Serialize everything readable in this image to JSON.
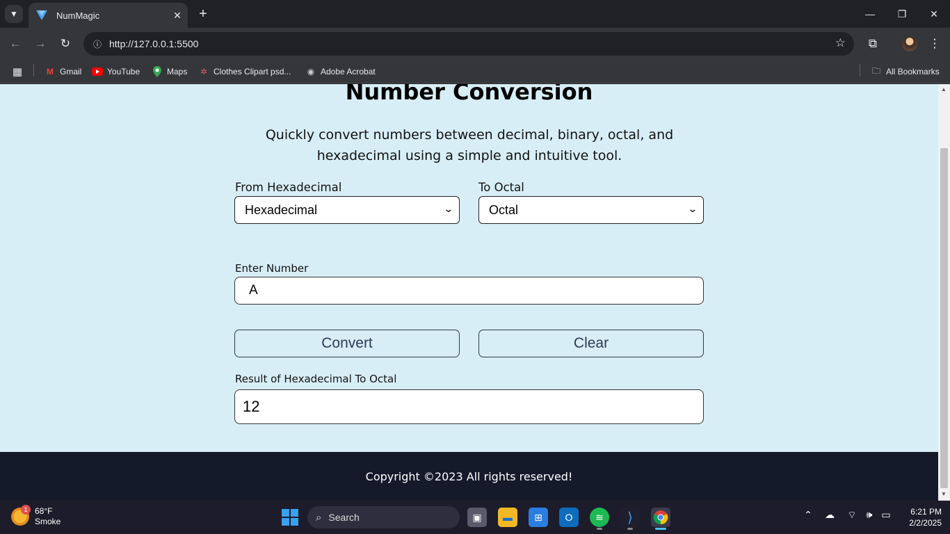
{
  "browser": {
    "tab_title": "NumMagic",
    "url": "http://127.0.0.1:5500",
    "bookmarks": [
      {
        "label": "Gmail",
        "icon": "gmail-icon"
      },
      {
        "label": "YouTube",
        "icon": "youtube-icon"
      },
      {
        "label": "Maps",
        "icon": "maps-icon"
      },
      {
        "label": "Clothes Clipart psd...",
        "icon": "clothes-clipart-icon"
      },
      {
        "label": "Adobe Acrobat",
        "icon": "adobe-acrobat-icon"
      }
    ],
    "all_bookmarks": "All Bookmarks"
  },
  "page": {
    "heading": "Number Conversion",
    "description": "Quickly convert numbers between decimal, binary, octal, and hexadecimal using a simple and intuitive tool.",
    "from_label": "From Hexadecimal",
    "from_value": "Hexadecimal",
    "to_label": "To Octal",
    "to_value": "Octal",
    "input_label": "Enter Number",
    "input_value": "A",
    "convert_label": "Convert",
    "clear_label": "Clear",
    "result_label": "Result of Hexadecimal To Octal",
    "result_value": "12",
    "footer": "Copyright ©2023 All rights reserved!"
  },
  "taskbar": {
    "weather_temp": "68°F",
    "weather_desc": "Smoke",
    "weather_badge": "1",
    "search_label": "Search",
    "time": "6:21 PM",
    "date": "2/2/2025"
  },
  "colors": {
    "page_bg": "#d8eef6",
    "footer_bg": "#141a2a",
    "chrome_dark": "#202124",
    "chrome_toolbar": "#35363a"
  }
}
